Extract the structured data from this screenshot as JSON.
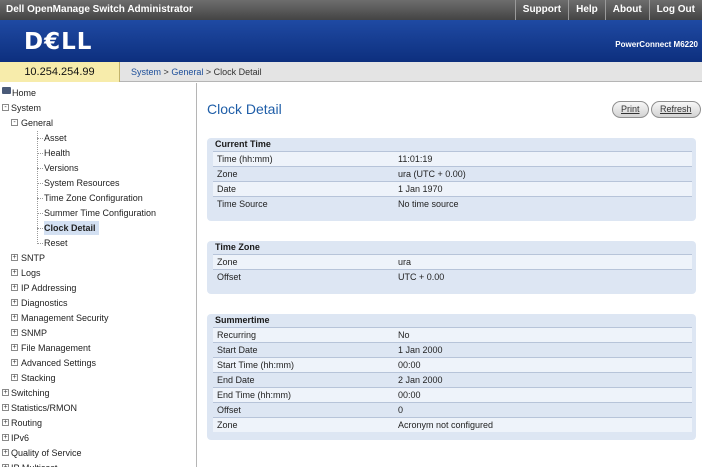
{
  "app": {
    "title": "Dell OpenManage Switch Administrator",
    "logo": "D€LL",
    "product": "PowerConnect M6220",
    "top_links": [
      "Support",
      "Help",
      "About",
      "Log Out"
    ]
  },
  "address": {
    "ip": "10.254.254.99",
    "breadcrumb": [
      "System",
      "General",
      "Clock Detail"
    ],
    "separator": ">"
  },
  "nav": {
    "items": [
      {
        "label": "Home",
        "level": 0,
        "expander": "",
        "selected": false
      },
      {
        "label": "System",
        "level": 0,
        "expander": "-",
        "selected": false
      },
      {
        "label": "General",
        "level": 1,
        "expander": "-",
        "selected": false
      },
      {
        "label": "Asset",
        "level": 2,
        "expander": "",
        "selected": false
      },
      {
        "label": "Health",
        "level": 2,
        "expander": "",
        "selected": false
      },
      {
        "label": "Versions",
        "level": 2,
        "expander": "",
        "selected": false
      },
      {
        "label": "System Resources",
        "level": 2,
        "expander": "",
        "selected": false
      },
      {
        "label": "Time Zone Configuration",
        "level": 2,
        "expander": "",
        "selected": false
      },
      {
        "label": "Summer Time Configuration",
        "level": 2,
        "expander": "",
        "selected": false
      },
      {
        "label": "Clock Detail",
        "level": 2,
        "expander": "",
        "selected": true
      },
      {
        "label": "Reset",
        "level": 2,
        "expander": "",
        "selected": false
      },
      {
        "label": "SNTP",
        "level": 1,
        "expander": "+",
        "selected": false
      },
      {
        "label": "Logs",
        "level": 1,
        "expander": "+",
        "selected": false
      },
      {
        "label": "IP Addressing",
        "level": 1,
        "expander": "+",
        "selected": false
      },
      {
        "label": "Diagnostics",
        "level": 1,
        "expander": "+",
        "selected": false
      },
      {
        "label": "Management Security",
        "level": 1,
        "expander": "+",
        "selected": false
      },
      {
        "label": "SNMP",
        "level": 1,
        "expander": "+",
        "selected": false
      },
      {
        "label": "File Management",
        "level": 1,
        "expander": "+",
        "selected": false
      },
      {
        "label": "Advanced Settings",
        "level": 1,
        "expander": "+",
        "selected": false
      },
      {
        "label": "Stacking",
        "level": 1,
        "expander": "+",
        "selected": false
      },
      {
        "label": "Switching",
        "level": 0,
        "expander": "+",
        "selected": false
      },
      {
        "label": "Statistics/RMON",
        "level": 0,
        "expander": "+",
        "selected": false
      },
      {
        "label": "Routing",
        "level": 0,
        "expander": "+",
        "selected": false
      },
      {
        "label": "IPv6",
        "level": 0,
        "expander": "+",
        "selected": false
      },
      {
        "label": "Quality of Service",
        "level": 0,
        "expander": "+",
        "selected": false
      },
      {
        "label": "IP Multicast",
        "level": 0,
        "expander": "+",
        "selected": false
      }
    ]
  },
  "content": {
    "title": "Clock Detail",
    "print_label": "Print",
    "refresh_label": "Refresh",
    "current_time": {
      "heading": "Current Time",
      "rows": [
        {
          "k": "Time (hh:mm)",
          "v": "11:01:19"
        },
        {
          "k": "Zone",
          "v": "ura (UTC + 0.00)"
        },
        {
          "k": "Date",
          "v": "1 Jan 1970"
        },
        {
          "k": "Time Source",
          "v": "No time source"
        }
      ]
    },
    "time_zone": {
      "heading": "Time Zone",
      "rows": [
        {
          "k": "Zone",
          "v": "ura"
        },
        {
          "k": "Offset",
          "v": "UTC + 0.00"
        }
      ]
    },
    "summertime": {
      "heading": "Summertime",
      "rows": [
        {
          "k": "Recurring",
          "v": "No"
        },
        {
          "k": "Start Date",
          "v": "1 Jan 2000"
        },
        {
          "k": "Start Time (hh:mm)",
          "v": "00:00"
        },
        {
          "k": "End Date",
          "v": "2 Jan 2000"
        },
        {
          "k": "End Time (hh:mm)",
          "v": "00:00"
        },
        {
          "k": "Offset",
          "v": "0"
        },
        {
          "k": "Zone",
          "v": "Acronym not configured"
        }
      ]
    }
  }
}
